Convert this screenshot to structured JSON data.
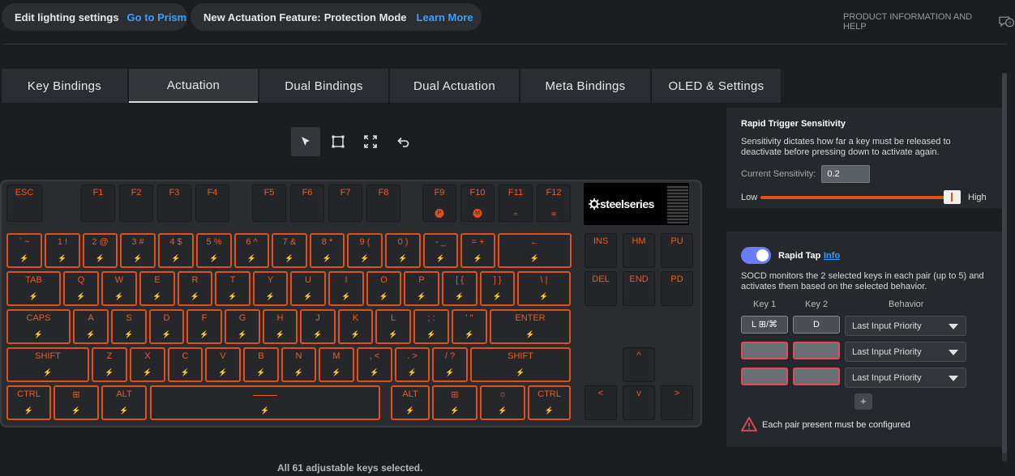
{
  "banner": {
    "lighting_label": "Edit lighting settings",
    "lighting_link": "Go to Prism",
    "feature_label": "New Actuation Feature:",
    "feature_name": "Protection Mode",
    "feature_link": "Learn More",
    "help_label": "PRODUCT INFORMATION AND HELP"
  },
  "tabs": [
    "Key Bindings",
    "Actuation",
    "Dual Bindings",
    "Dual Actuation",
    "Meta Bindings",
    "OLED & Settings"
  ],
  "active_tab": "Actuation",
  "toolbar": [
    "pointer-select",
    "rect-select",
    "select-all",
    "undo"
  ],
  "keyboard": {
    "brand": "steelseries",
    "rows": [
      [
        "ESC",
        "F1",
        "F2",
        "F3",
        "F4",
        "F5",
        "F6",
        "F7",
        "F8",
        "F9",
        "F10",
        "F11",
        "F12"
      ],
      [
        "` ~",
        "1 !",
        "2 @",
        "3 #",
        "4 $",
        "5 %",
        "6 ^",
        "7 &",
        "8 *",
        "9 (",
        "0 )",
        "- _",
        "= +",
        "←",
        "INS",
        "HM",
        "PU"
      ],
      [
        "TAB",
        "Q",
        "W",
        "E",
        "R",
        "T",
        "Y",
        "U",
        "I",
        "O",
        "P",
        "[ {",
        "] }",
        "\\ |",
        "DEL",
        "END",
        "PD"
      ],
      [
        "CAPS",
        "A",
        "S",
        "D",
        "F",
        "G",
        "H",
        "J",
        "K",
        "L",
        "; :",
        "' \"",
        "ENTER"
      ],
      [
        "SHIFT",
        "Z",
        "X",
        "C",
        "V",
        "B",
        "N",
        "M",
        ", <",
        ". >",
        "/ ?",
        "SHIFT",
        "^"
      ],
      [
        "CTRL",
        "⊞",
        "ALT",
        "",
        "ALT",
        "⊞",
        "☼",
        "CTRL",
        "<",
        "v",
        ">"
      ]
    ]
  },
  "status_text": "All 61 adjustable keys selected.",
  "rapid_trigger": {
    "title": "Rapid Trigger Sensitivity",
    "description": "Sensitivity dictates how far a key must be released to deactivate before pressing down to activate again.",
    "current_label": "Current Sensitivity:",
    "current_value": "0.2",
    "low_label": "Low",
    "high_label": "High",
    "slider_level": 0.95
  },
  "rapid_tap": {
    "enabled": true,
    "label": "Rapid Tap",
    "info_link": "Info",
    "description": "SOCD monitors the 2 selected keys in each pair (up to 5) and activates them based on the selected behavior.",
    "col_key1": "Key 1",
    "col_key2": "Key 2",
    "col_behavior": "Last Input Priority",
    "col_behavior_header": "Behavior",
    "pairs": [
      {
        "key1": "L ⊞/⌘",
        "key2": "D",
        "behavior": "Last Input Priority"
      },
      {
        "key1": "",
        "key2": "",
        "behavior": "Last Input Priority"
      },
      {
        "key1": "",
        "key2": "",
        "behavior": "Last Input Priority"
      }
    ],
    "add_label": "+",
    "warning": "Each pair present must be configured"
  },
  "colors": {
    "accent": "#e0501a",
    "link": "#3aa0ff",
    "toggle": "#6a7cff",
    "warn": "#e04e5e"
  }
}
